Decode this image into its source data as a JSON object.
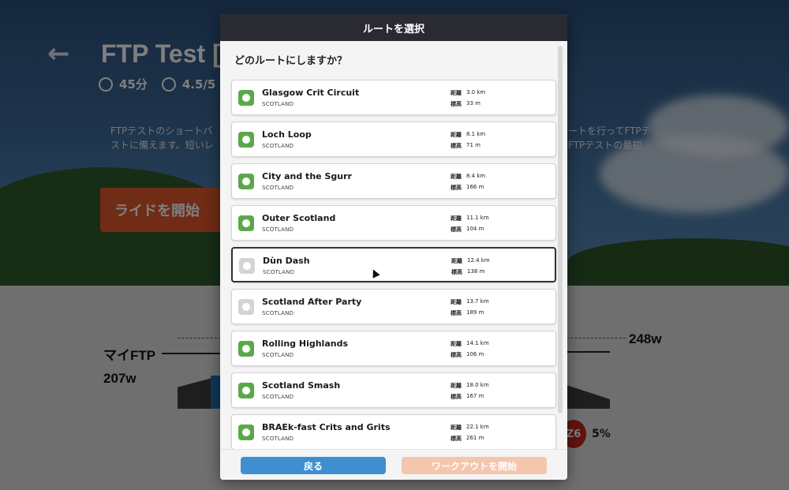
{
  "background": {
    "back_arrow": "←",
    "workout_title": "FTP Test [S",
    "duration": "45分",
    "rating": "4.5/5 エ",
    "desc_left_line1": "FTPテストのショートバ",
    "desc_left_line2": "ストに備えます。短いレ",
    "desc_right_line1": "ートを行ってFTPテ",
    "desc_right_line2": "FTPテストの最初…",
    "ride_button": "ライドを開始",
    "my_ftp_label": "マイFTP",
    "my_ftp_value": "207w",
    "target_value": "248w",
    "zone_badge": "Z6",
    "zone_percent": "5%"
  },
  "modal": {
    "title": "ルートを選択",
    "question": "どのルートにしますか？",
    "distance_key": "距離",
    "elevation_key": "標高",
    "routes": [
      {
        "name": "Glasgow Crit Circuit",
        "region": "SCOTLAND",
        "distance": "3.0 km",
        "elevation": "33 m"
      },
      {
        "name": "Loch Loop",
        "region": "SCOTLAND",
        "distance": "8.1 km",
        "elevation": "71 m"
      },
      {
        "name": "City and the Sgurr",
        "region": "SCOTLAND",
        "distance": "8.4 km",
        "elevation": "166 m"
      },
      {
        "name": "Outer Scotland",
        "region": "SCOTLAND",
        "distance": "11.1 km",
        "elevation": "104 m"
      },
      {
        "name": "Dùn Dash",
        "region": "SCOTLAND",
        "distance": "12.4 km",
        "elevation": "138 m"
      },
      {
        "name": "Scotland After Party",
        "region": "SCOTLAND",
        "distance": "13.7 km",
        "elevation": "189 m"
      },
      {
        "name": "Rolling Highlands",
        "region": "SCOTLAND",
        "distance": "14.1 km",
        "elevation": "106 m"
      },
      {
        "name": "Scotland Smash",
        "region": "SCOTLAND",
        "distance": "18.0 km",
        "elevation": "167 m"
      },
      {
        "name": "BRAEk-fast Crits and Grits",
        "region": "SCOTLAND",
        "distance": "22.1 km",
        "elevation": "261 m"
      }
    ],
    "back_button": "戻る",
    "start_button": "ワークアウトを開始"
  },
  "colors": {
    "header_bg": "#2a2a33",
    "route_icon_active": "#5ba84c",
    "route_icon_inactive": "#d4d4d4",
    "back_button": "#3f8fd0",
    "start_button_disabled": "#f4c6ad",
    "zone6": "#c0281e"
  }
}
